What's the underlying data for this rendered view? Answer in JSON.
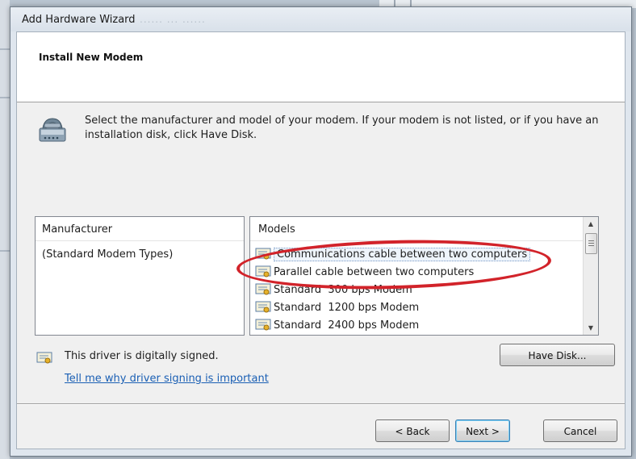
{
  "window": {
    "title": "Add Hardware Wizard",
    "title_ghost": "...... ... ......"
  },
  "header": {
    "title": "Install New Modem"
  },
  "instruction": "Select the manufacturer and model of your modem. If your modem is not listed, or if you have an installation disk, click Have Disk.",
  "manufacturer": {
    "header": "Manufacturer",
    "items": [
      "(Standard Modem Types)"
    ]
  },
  "models": {
    "header": "Models",
    "items": [
      "Communications cable between two computers",
      "Parallel cable between two computers",
      "Standard  300 bps Modem",
      "Standard  1200 bps Modem",
      "Standard  2400 bps Modem"
    ],
    "selected_index": 0
  },
  "signing": {
    "status": "This driver is digitally signed.",
    "link": "Tell me why driver signing is important"
  },
  "buttons": {
    "have_disk": "Have Disk...",
    "back": "< Back",
    "next": "Next >",
    "cancel": "Cancel"
  },
  "colors": {
    "annotation": "#d2232a",
    "link": "#1a5fb4",
    "focus_border": "#3c7fb1"
  },
  "icons": {
    "modem": "modem-icon",
    "cert": "certificate-icon",
    "scroll_up": "scroll-up-icon",
    "scroll_down": "scroll-down-icon"
  }
}
